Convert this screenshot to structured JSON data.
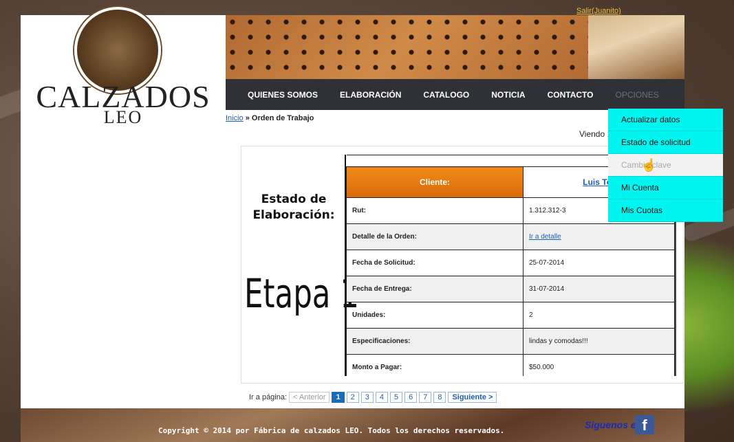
{
  "header": {
    "logo_line1": "CALZADOS",
    "logo_line2": "LEO",
    "user_link": "Salir(Juanito)"
  },
  "nav": {
    "items": [
      "QUIENES SOMOS",
      "ELABORACIÓN",
      "CATALOGO",
      "NOTICIA",
      "CONTACTO",
      "OPCIONES"
    ]
  },
  "dropdown": {
    "items": [
      "Actualizar datos",
      "Estado de solicitud",
      "Cambio clave",
      "Mi Cuenta",
      "Mis Cuotas"
    ],
    "hovered": "Cambio clave"
  },
  "breadcrumb": {
    "home": "Inicio",
    "separator": " » ",
    "current": "Orden de Trabajo"
  },
  "viendo": "Viendo 1",
  "estado": {
    "label": "Estado de Elaboración:",
    "etapa": "Etapa 1"
  },
  "table": {
    "header_label": "Cliente:",
    "header_value": "Luis Tor",
    "rows": [
      {
        "key": "Rut:",
        "value": "1.312.312-3"
      },
      {
        "key": "Detalle de la Orden:",
        "value": "Ir a detalle"
      },
      {
        "key": "Fecha de Solicitud:",
        "value": "25-07-2014"
      },
      {
        "key": "Fecha de Entrega:",
        "value": "31-07-2014"
      },
      {
        "key": "Unidades:",
        "value": "2"
      },
      {
        "key": "Especificaciones:",
        "value": "lindas y comodas!!!"
      },
      {
        "key": "Monto a Pagar:",
        "value": "$50.000"
      }
    ]
  },
  "pager": {
    "label": "Ir a página:",
    "prev": "< Anterior",
    "pages": [
      "1",
      "2",
      "3",
      "4",
      "5",
      "6",
      "7",
      "8"
    ],
    "current": "1",
    "next": "Siguiente >"
  },
  "footer": {
    "copyright": "Copyright © 2014 por Fábrica de calzados LEO. Todos los derechos reservados.",
    "follow": "Siguenos en:",
    "facebook_icon": "facebook-icon"
  }
}
